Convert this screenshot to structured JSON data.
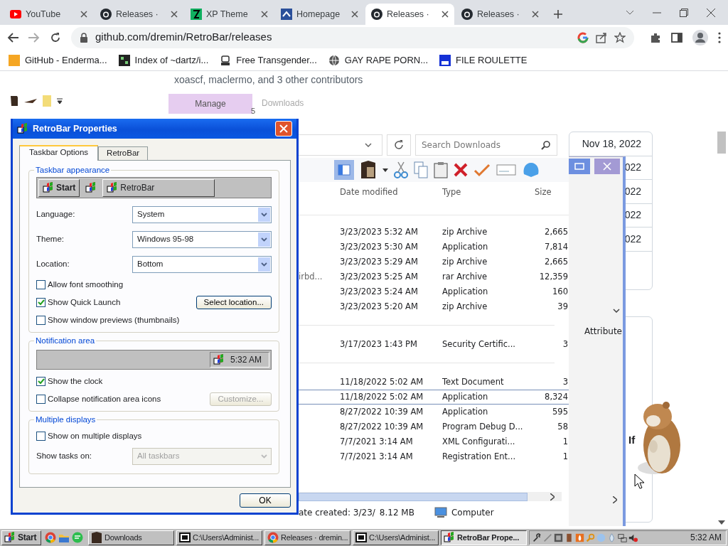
{
  "browser": {
    "tabs": [
      {
        "label": "YouTube",
        "kind": "youtube",
        "selected": false
      },
      {
        "label": "Releases ·",
        "kind": "github",
        "selected": false
      },
      {
        "label": "XP Theme",
        "kind": "xp",
        "selected": false
      },
      {
        "label": "Homepage",
        "kind": "homepage",
        "selected": false
      },
      {
        "label": "Releases ·",
        "kind": "github",
        "selected": true
      },
      {
        "label": "Releases ·",
        "kind": "github",
        "selected": false
      }
    ],
    "address": "github.com/dremin/RetroBar/releases",
    "bookmarks": [
      {
        "label": "GitHub - Enderma...",
        "kind": "ph"
      },
      {
        "label": "Index of ~dartz/i...",
        "kind": "index"
      },
      {
        "label": "Free Transgender...",
        "kind": "robot"
      },
      {
        "label": "GAY RAPE PORN...",
        "kind": "globe"
      },
      {
        "label": "FILE ROULETTE",
        "kind": "mf"
      }
    ]
  },
  "github": {
    "contributors": "xoascf, maclermo, and 3 other contributors",
    "manage": "Manage",
    "downloads": "Downloads",
    "count": "5",
    "dates": [
      "Nov 18, 2022",
      "022",
      "022",
      "022",
      "022"
    ],
    "fragment": "If"
  },
  "explorer": {
    "search_placeholder": "Search Downloads",
    "columns": [
      "Date modified",
      "Type",
      "Size"
    ],
    "groups": [
      {
        "rows": [
          {
            "date": "3/23/2023 5:32 AM",
            "type": "zip Archive",
            "size": "2,665",
            "selected": false
          },
          {
            "date": "3/23/2023 5:30 AM",
            "type": "Application",
            "size": "7,814",
            "selected": false
          },
          {
            "date": "3/23/2023 5:29 AM",
            "type": "zip Archive",
            "size": "2,665",
            "selected": false
          },
          {
            "name": "irbd...",
            "date": "3/23/2023 5:25 AM",
            "type": "rar Archive",
            "size": "12,359",
            "selected": false
          },
          {
            "date": "3/23/2023 5:24 AM",
            "type": "Application",
            "size": "160",
            "selected": false
          },
          {
            "date": "3/23/2023 5:20 AM",
            "type": "zip Archive",
            "size": "39",
            "selected": false
          }
        ]
      },
      {
        "rows": [
          {
            "date": "3/17/2023 1:43 PM",
            "type": "Security Certific...",
            "size": "3",
            "selected": false
          }
        ]
      },
      {
        "rows": [
          {
            "date": "11/18/2022 5:02 AM",
            "type": "Text Document",
            "size": "3",
            "selected": false
          },
          {
            "date": "11/18/2022 5:02 AM",
            "type": "Application",
            "size": "8,324",
            "selected": true
          },
          {
            "date": "8/27/2022 10:39 AM",
            "type": "Application",
            "size": "595",
            "selected": false
          },
          {
            "date": "8/27/2022 10:39 AM",
            "type": "Program Debug D...",
            "size": "58",
            "selected": false
          },
          {
            "date": "7/7/2021 3:14 AM",
            "type": "XML Configurati...",
            "size": "1",
            "selected": false
          },
          {
            "date": "7/7/2021 3:14 AM",
            "type": "Registration Ent...",
            "size": "1",
            "selected": false
          }
        ]
      }
    ],
    "attribute_column": "Attribute",
    "status": [
      "ate created: 3/23/",
      "8.12 MB"
    ],
    "location": "Computer"
  },
  "dialog": {
    "title": "RetroBar Properties",
    "tabs": [
      {
        "label": "Taskbar Options",
        "selected": true
      },
      {
        "label": "RetroBar",
        "selected": false
      }
    ],
    "appearance": {
      "legend": "Taskbar appearance",
      "start": "Start",
      "task": "RetroBar",
      "fields": [
        {
          "label": "Language:",
          "value": "System"
        },
        {
          "label": "Theme:",
          "value": "Windows 95-98"
        },
        {
          "label": "Location:",
          "value": "Bottom"
        }
      ],
      "options": [
        {
          "label": "Allow font smoothing",
          "checked": false
        },
        {
          "label": "Show Quick Launch",
          "checked": true,
          "button": "Select location...",
          "button_disabled": false
        },
        {
          "label": "Show window previews (thumbnails)",
          "checked": false
        }
      ]
    },
    "notification": {
      "legend": "Notification area",
      "clock": "5:32 AM",
      "options": [
        {
          "label": "Show the clock",
          "checked": true
        },
        {
          "label": "Collapse notification area icons",
          "checked": false,
          "button": "Customize...",
          "button_disabled": true
        }
      ]
    },
    "multiple": {
      "legend": "Multiple displays",
      "options": [
        {
          "label": "Show on multiple displays",
          "checked": false
        }
      ],
      "field": {
        "label": "Show tasks on:",
        "value": "All taskbars",
        "disabled": true
      }
    },
    "ok": "OK"
  },
  "taskbar": {
    "start": "Start",
    "items": [
      {
        "label": "Downloads",
        "kind": "folder",
        "selected": false
      },
      {
        "label": "C:\\Users\\Administ...",
        "kind": "archive",
        "selected": false
      },
      {
        "label": "Releases · dremin...",
        "kind": "chrome",
        "selected": false
      },
      {
        "label": "C:\\Users\\Administ...",
        "kind": "archive",
        "selected": false
      },
      {
        "label": "RetroBar Prope...",
        "kind": "retrobar",
        "selected": true
      }
    ],
    "clock": "5:32 AM"
  }
}
